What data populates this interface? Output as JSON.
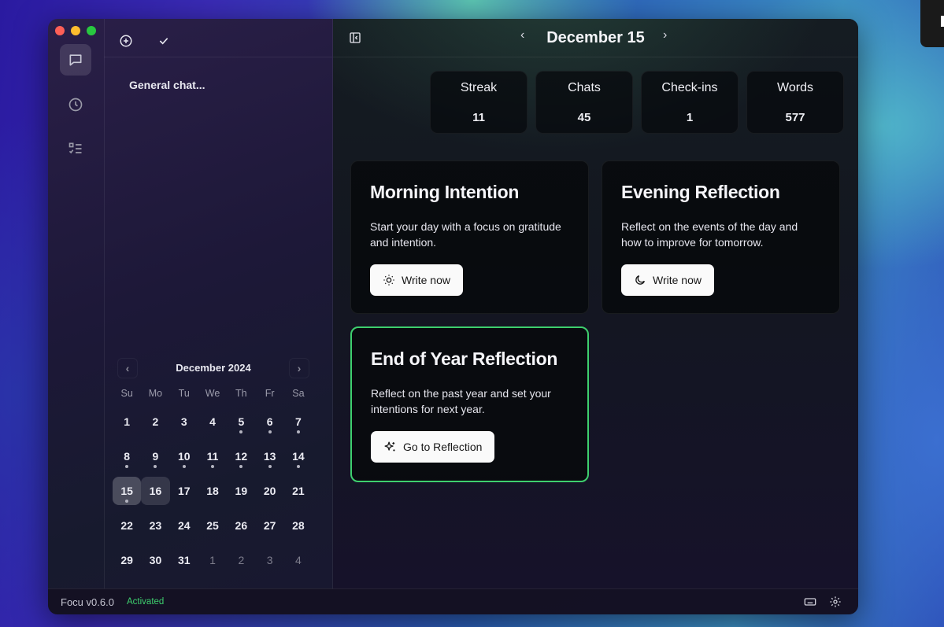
{
  "header": {
    "title": "December 15",
    "prev_day": "‹",
    "next_day": "›"
  },
  "sidebar": {
    "chat_items": [
      "General chat..."
    ],
    "icons": [
      "chat-icon",
      "clock-icon",
      "checklist-icon",
      "new-chat-icon",
      "check-icon",
      "collapse-sidebar-icon"
    ]
  },
  "stats": [
    {
      "label": "Streak",
      "value": "11"
    },
    {
      "label": "Chats",
      "value": "45"
    },
    {
      "label": "Check-ins",
      "value": "1"
    },
    {
      "label": "Words",
      "value": "577"
    }
  ],
  "cards": [
    {
      "title": "Morning Intention",
      "text": "Start your day with a focus on gratitude and intention.",
      "button": "Write now",
      "icon": "sun-icon"
    },
    {
      "title": "Evening Reflection",
      "text": "Reflect on the events of the day and how to improve for tomorrow.",
      "button": "Write now",
      "icon": "moon-icon"
    },
    {
      "title": "End of Year Reflection",
      "text": "Reflect on the past year and set your intentions for next year.",
      "button": "Go to Reflection",
      "icon": "sparkles-icon"
    }
  ],
  "calendar": {
    "month_label": "December 2024",
    "weekdays": [
      "Su",
      "Mo",
      "Tu",
      "We",
      "Th",
      "Fr",
      "Sa"
    ],
    "days": [
      {
        "d": "1"
      },
      {
        "d": "2"
      },
      {
        "d": "3"
      },
      {
        "d": "4"
      },
      {
        "d": "5",
        "dot": true
      },
      {
        "d": "6",
        "dot": true
      },
      {
        "d": "7",
        "dot": true
      },
      {
        "d": "8",
        "dot": true
      },
      {
        "d": "9",
        "dot": true
      },
      {
        "d": "10",
        "dot": true
      },
      {
        "d": "11",
        "dot": true
      },
      {
        "d": "12",
        "dot": true
      },
      {
        "d": "13",
        "dot": true
      },
      {
        "d": "14",
        "dot": true
      },
      {
        "d": "15",
        "dot": true,
        "selected": true
      },
      {
        "d": "16",
        "today": true
      },
      {
        "d": "17"
      },
      {
        "d": "18"
      },
      {
        "d": "19"
      },
      {
        "d": "20"
      },
      {
        "d": "21"
      },
      {
        "d": "22"
      },
      {
        "d": "23"
      },
      {
        "d": "24"
      },
      {
        "d": "25"
      },
      {
        "d": "26"
      },
      {
        "d": "27"
      },
      {
        "d": "28"
      },
      {
        "d": "29"
      },
      {
        "d": "30"
      },
      {
        "d": "31"
      },
      {
        "d": "1",
        "muted": true
      },
      {
        "d": "2",
        "muted": true
      },
      {
        "d": "3",
        "muted": true
      },
      {
        "d": "4",
        "muted": true
      }
    ]
  },
  "footer": {
    "version": "Focu v0.6.0",
    "status": "Activated",
    "status_color": "#3ecf6e"
  },
  "colors": {
    "accent": "#3ecf6e"
  }
}
